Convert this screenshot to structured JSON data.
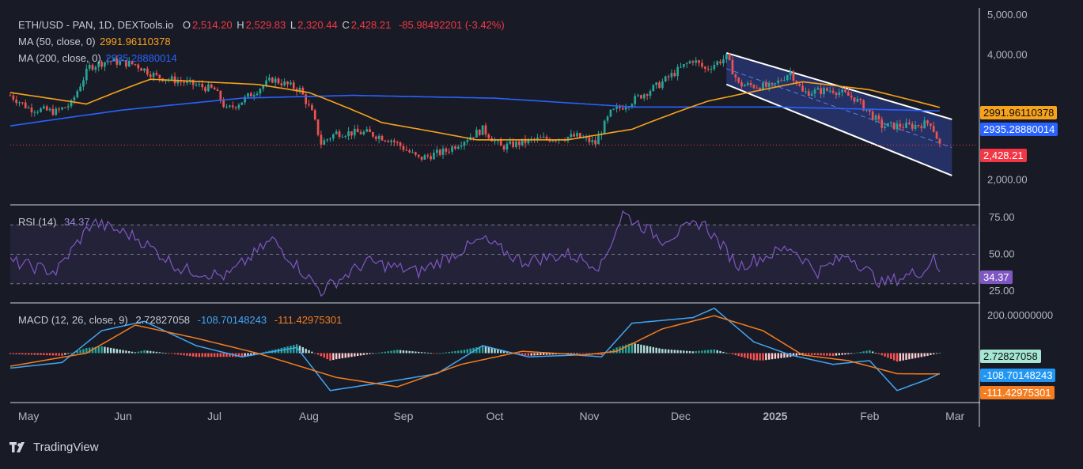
{
  "header": {
    "symbol": "ETH/USD - PAN, 1D, DEXTools.io",
    "open_label": "O",
    "open": "2,514.20",
    "high_label": "H",
    "high": "2,529.83",
    "low_label": "L",
    "low": "2,320.44",
    "close_label": "C",
    "close": "2,428.21",
    "change": "-85.98492201 (-3.42%)"
  },
  "ma50": {
    "label": "MA (50, close, 0)",
    "value": "2991.96110378",
    "color": "#f7a21b"
  },
  "ma200": {
    "label": "MA (200, close, 0)",
    "value": "2935.28880014",
    "color": "#2962ff"
  },
  "price_tags": {
    "ma50": "2991.96110378",
    "ma200": "2935.28880014",
    "last": "2,428.21"
  },
  "rsi": {
    "label": "RSI (14)",
    "value": "34.37",
    "color": "#9b87e0"
  },
  "macd": {
    "label": "MACD (12, 26, close, 9)",
    "hist": "2.72827058",
    "macd": "-108.70148243",
    "signal": "-111.42975301"
  },
  "footer": {
    "brand": "TradingView"
  },
  "colors": {
    "up": "#26a69a",
    "down": "#ef5350",
    "channel": "#2a3a7a"
  },
  "chart_data": [
    {
      "type": "candlestick",
      "title": "ETH/USD - PAN, 1D, DEXTools.io",
      "y_scale": "log",
      "ylim": [
        1750,
        5200
      ],
      "y_ticks": [
        "5,000.00",
        "4,000.00",
        "2,000.00"
      ],
      "y_tick_values": [
        5000,
        4000,
        2000
      ],
      "x_ticks": [
        "May",
        "Jun",
        "Jul",
        "Aug",
        "Sep",
        "Oct",
        "Nov",
        "Dec",
        "2025",
        "Feb",
        "Mar"
      ],
      "close_path": [
        [
          "2024-04-25",
          3200
        ],
        [
          "2024-05-01",
          2980
        ],
        [
          "2024-05-10",
          2920
        ],
        [
          "2024-05-15",
          3050
        ],
        [
          "2024-05-21",
          3750
        ],
        [
          "2024-05-27",
          3880
        ],
        [
          "2024-06-05",
          3800
        ],
        [
          "2024-06-12",
          3550
        ],
        [
          "2024-06-18",
          3480
        ],
        [
          "2024-06-24",
          3400
        ],
        [
          "2024-07-01",
          3300
        ],
        [
          "2024-07-05",
          2950
        ],
        [
          "2024-07-10",
          3100
        ],
        [
          "2024-07-20",
          3500
        ],
        [
          "2024-07-29",
          3300
        ],
        [
          "2024-08-02",
          2900
        ],
        [
          "2024-08-05",
          2450
        ],
        [
          "2024-08-10",
          2600
        ],
        [
          "2024-08-20",
          2600
        ],
        [
          "2024-08-28",
          2500
        ],
        [
          "2024-09-06",
          2250
        ],
        [
          "2024-09-15",
          2350
        ],
        [
          "2024-09-27",
          2650
        ],
        [
          "2024-10-03",
          2400
        ],
        [
          "2024-10-14",
          2500
        ],
        [
          "2024-10-28",
          2550
        ],
        [
          "2024-11-03",
          2450
        ],
        [
          "2024-11-08",
          2900
        ],
        [
          "2024-11-15",
          3100
        ],
        [
          "2024-11-24",
          3400
        ],
        [
          "2024-12-05",
          3900
        ],
        [
          "2024-12-09",
          3700
        ],
        [
          "2024-12-16",
          3950
        ],
        [
          "2024-12-20",
          3400
        ],
        [
          "2024-12-31",
          3350
        ],
        [
          "2025-01-06",
          3650
        ],
        [
          "2025-01-10",
          3250
        ],
        [
          "2025-01-20",
          3300
        ],
        [
          "2025-01-27",
          3150
        ],
        [
          "2025-02-02",
          2850
        ],
        [
          "2025-02-05",
          2700
        ],
        [
          "2025-02-15",
          2700
        ],
        [
          "2025-02-21",
          2750
        ],
        [
          "2025-02-24",
          2428
        ]
      ],
      "ma50_path": [
        [
          "2024-04-25",
          3250
        ],
        [
          "2024-05-20",
          3050
        ],
        [
          "2024-06-10",
          3500
        ],
        [
          "2024-07-15",
          3400
        ],
        [
          "2024-08-01",
          3250
        ],
        [
          "2024-08-25",
          2750
        ],
        [
          "2024-09-25",
          2500
        ],
        [
          "2024-10-25",
          2500
        ],
        [
          "2024-11-15",
          2650
        ],
        [
          "2024-12-10",
          3100
        ],
        [
          "2025-01-10",
          3450
        ],
        [
          "2025-02-01",
          3300
        ],
        [
          "2025-02-24",
          2992
        ]
      ],
      "ma200_path": [
        [
          "2024-04-25",
          2700
        ],
        [
          "2024-06-01",
          2950
        ],
        [
          "2024-07-10",
          3150
        ],
        [
          "2024-08-15",
          3200
        ],
        [
          "2024-10-01",
          3150
        ],
        [
          "2024-11-15",
          3000
        ],
        [
          "2025-01-01",
          3000
        ],
        [
          "2025-02-24",
          2935
        ]
      ],
      "channel_upper": [
        [
          "2024-12-16",
          4050
        ],
        [
          "2025-02-28",
          2800
        ]
      ],
      "channel_lower": [
        [
          "2024-12-16",
          3400
        ],
        [
          "2025-02-28",
          2050
        ]
      ],
      "last_price": 2428.21
    },
    {
      "type": "line",
      "title": "RSI (14)",
      "ylim": [
        18,
        82
      ],
      "y_ticks": [
        "75.00",
        "50.00",
        "25.00"
      ],
      "y_tick_values": [
        75,
        50,
        25
      ],
      "bands": [
        70,
        50,
        30
      ],
      "path": [
        [
          "2024-04-25",
          45
        ],
        [
          "2024-05-10",
          38
        ],
        [
          "2024-05-22",
          72
        ],
        [
          "2024-06-05",
          62
        ],
        [
          "2024-06-20",
          40
        ],
        [
          "2024-07-05",
          35
        ],
        [
          "2024-07-20",
          60
        ],
        [
          "2024-08-05",
          25
        ],
        [
          "2024-08-20",
          45
        ],
        [
          "2024-09-06",
          38
        ],
        [
          "2024-09-27",
          60
        ],
        [
          "2024-10-10",
          45
        ],
        [
          "2024-10-25",
          50
        ],
        [
          "2024-11-05",
          42
        ],
        [
          "2024-11-12",
          78
        ],
        [
          "2024-11-25",
          60
        ],
        [
          "2024-12-08",
          72
        ],
        [
          "2024-12-20",
          42
        ],
        [
          "2025-01-06",
          55
        ],
        [
          "2025-01-15",
          38
        ],
        [
          "2025-01-25",
          50
        ],
        [
          "2025-02-05",
          30
        ],
        [
          "2025-02-20",
          40
        ],
        [
          "2025-02-22",
          52
        ],
        [
          "2025-02-24",
          34.37
        ]
      ]
    },
    {
      "type": "line",
      "title": "MACD (12, 26, close, 9)",
      "ylim": [
        -260,
        260
      ],
      "y_ticks": [
        "200.00000000"
      ],
      "y_tick_values": [
        200
      ],
      "series": [
        {
          "name": "MACD",
          "color": "#42a5f5",
          "path": [
            [
              "2024-04-25",
              -80
            ],
            [
              "2024-05-12",
              -50
            ],
            [
              "2024-05-25",
              120
            ],
            [
              "2024-06-08",
              170
            ],
            [
              "2024-06-25",
              40
            ],
            [
              "2024-07-10",
              -20
            ],
            [
              "2024-07-28",
              30
            ],
            [
              "2024-08-08",
              -200
            ],
            [
              "2024-08-28",
              -150
            ],
            [
              "2024-09-12",
              -110
            ],
            [
              "2024-09-27",
              40
            ],
            [
              "2024-10-12",
              -20
            ],
            [
              "2024-10-28",
              -10
            ],
            [
              "2024-11-05",
              -20
            ],
            [
              "2024-11-15",
              160
            ],
            [
              "2024-12-05",
              190
            ],
            [
              "2024-12-12",
              240
            ],
            [
              "2024-12-25",
              60
            ],
            [
              "2025-01-06",
              -10
            ],
            [
              "2025-01-20",
              -60
            ],
            [
              "2025-02-01",
              -40
            ],
            [
              "2025-02-10",
              -200
            ],
            [
              "2025-02-20",
              -140
            ],
            [
              "2025-02-24",
              -108.7
            ]
          ]
        },
        {
          "name": "Signal",
          "color": "#f57c1f",
          "path": [
            [
              "2024-04-25",
              -70
            ],
            [
              "2024-05-20",
              0
            ],
            [
              "2024-06-05",
              150
            ],
            [
              "2024-06-25",
              80
            ],
            [
              "2024-07-15",
              0
            ],
            [
              "2024-08-10",
              -130
            ],
            [
              "2024-08-30",
              -180
            ],
            [
              "2024-09-20",
              -60
            ],
            [
              "2024-10-10",
              10
            ],
            [
              "2024-10-30",
              -10
            ],
            [
              "2024-11-10",
              10
            ],
            [
              "2024-11-25",
              130
            ],
            [
              "2024-12-12",
              200
            ],
            [
              "2024-12-28",
              120
            ],
            [
              "2025-01-10",
              -10
            ],
            [
              "2025-01-25",
              -40
            ],
            [
              "2025-02-10",
              -110
            ],
            [
              "2025-02-24",
              -111.43
            ]
          ]
        }
      ],
      "histogram_last": 2.72827058
    }
  ]
}
